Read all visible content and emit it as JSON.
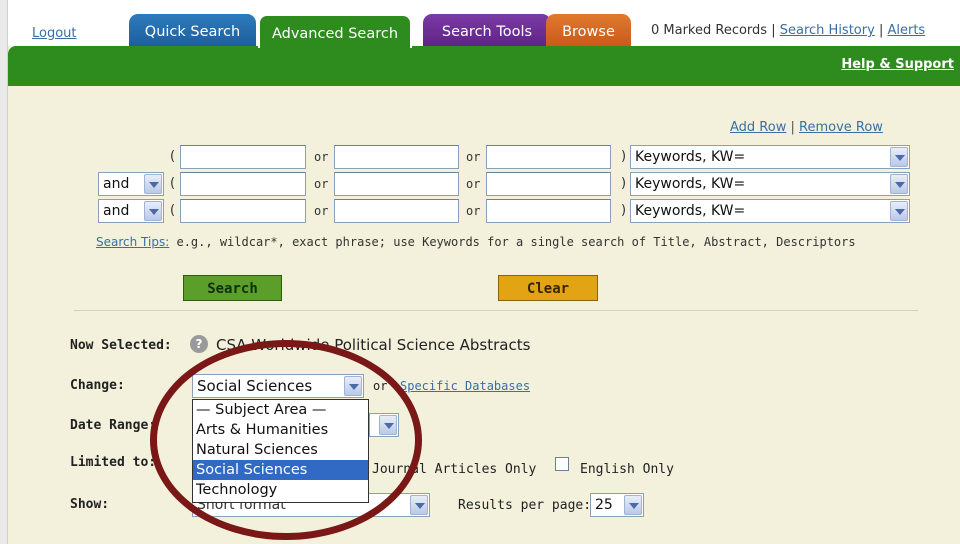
{
  "topbar": {
    "logout": "Logout",
    "tabs": [
      "Quick Search",
      "Advanced Search",
      "Search Tools",
      "Browse"
    ],
    "marked_records": "0 Marked Records",
    "sep": "|",
    "search_history": "Search History",
    "alerts": "Alerts",
    "help_support": "Help & Support"
  },
  "rows": {
    "add_row": "Add Row",
    "remove_row": "Remove Row",
    "or": "or",
    "open_paren": "(",
    "close_paren": ")",
    "field_select": "Keywords, KW=",
    "operator": "and"
  },
  "hint": {
    "link": "Search Tips:",
    "text": " e.g., wildcar*, exact phrase; use Keywords for a single search of Title, Abstract, Descriptors"
  },
  "buttons": {
    "search": "Search",
    "clear": "Clear"
  },
  "options_panel": {
    "now_selected_label": "Now Selected:",
    "help_icon": "?",
    "now_selected_value": "CSA Worldwide Political Science Abstracts",
    "change_label": "Change:",
    "change_value": "Social Sciences",
    "or_text": "or",
    "specific_databases": "Specific Databases",
    "dropdown_options": [
      "— Subject Area —",
      "Arts & Humanities",
      "Natural Sciences",
      "Social Sciences",
      "Technology"
    ],
    "date_range_label": "Date Range:",
    "limited_to_label": "Limited to:",
    "journal_articles_only": "Journal Articles Only",
    "english_only": "English Only",
    "show_label": "Show:",
    "show_value": "Short format",
    "results_per_page_label": "Results per page:",
    "results_per_page_value": "25"
  },
  "colors": {
    "green_bar": "#2e8b1e",
    "quick_tab": "#1d5d9a",
    "tools_tab": "#6a2b93",
    "browse_tab": "#d0632a",
    "search_button": "#5c9e2a",
    "clear_button": "#e3a413",
    "annotation_ring": "#7a1717"
  }
}
